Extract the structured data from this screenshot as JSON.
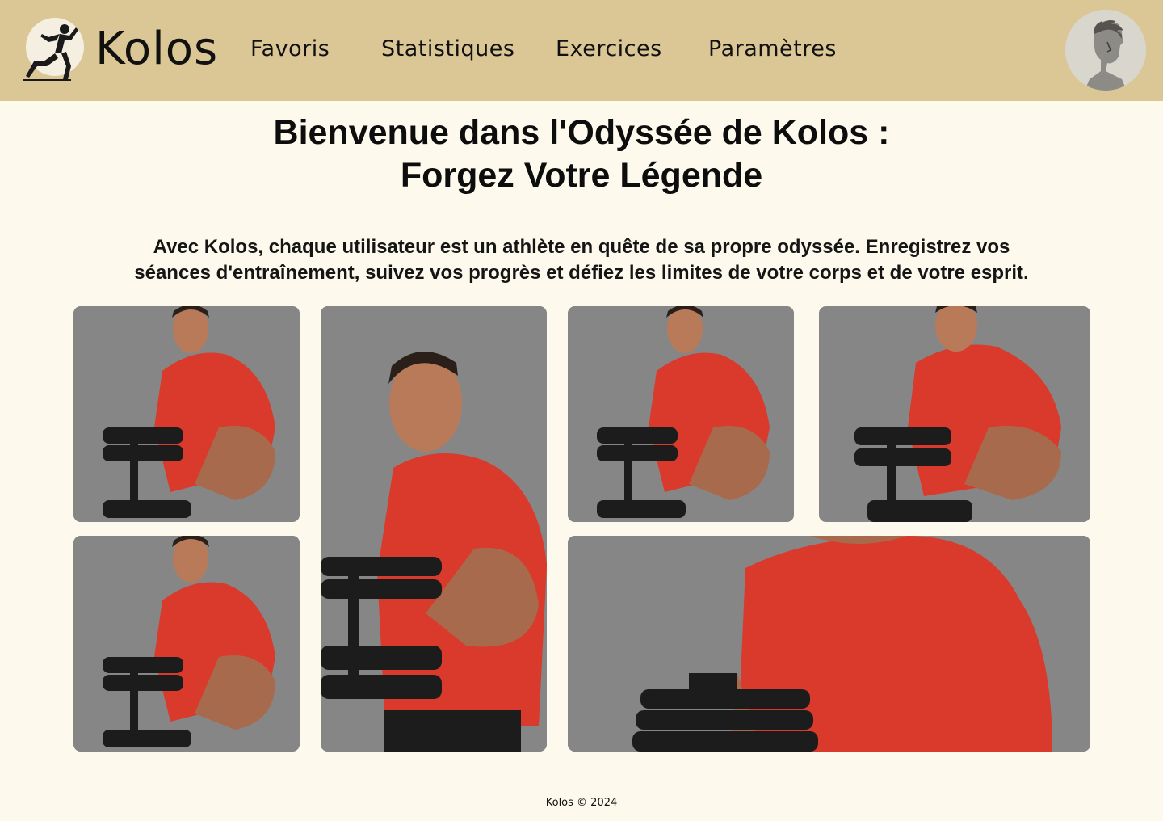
{
  "header": {
    "logo_text": "Kolos",
    "nav": [
      {
        "label": "Favoris"
      },
      {
        "label": "Statistiques"
      },
      {
        "label": "Exercices"
      },
      {
        "label": "Paramètres"
      }
    ],
    "colors": {
      "bar": "#dbc795",
      "page": "#fdf9ec"
    }
  },
  "hero": {
    "title_line1": "Bienvenue dans l'Odyssée de Kolos :",
    "title_line2": "Forgez Votre Légende",
    "description_line1": "Avec Kolos, chaque utilisateur est un athlète en quête de sa propre odyssée. Enregistrez vos",
    "description_line2": "séances d'entraînement, suivez vos progrès et défiez les limites de votre corps et de votre esprit."
  },
  "gallery": {
    "tiles": [
      {
        "icon": "athlete-dumbbell-photo"
      },
      {
        "icon": "athlete-dumbbell-photo"
      },
      {
        "icon": "athlete-dumbbell-photo"
      },
      {
        "icon": "athlete-dumbbell-photo"
      },
      {
        "icon": "athlete-dumbbell-photo"
      },
      {
        "icon": "athlete-torso-closeup-photo"
      }
    ],
    "colors": {
      "tile_bg": "#868686",
      "shirt": "#d93a2c",
      "skin": "#b97a5a",
      "weights": "#1c1c1c"
    }
  },
  "footer": {
    "text": "Kolos © 2024"
  }
}
